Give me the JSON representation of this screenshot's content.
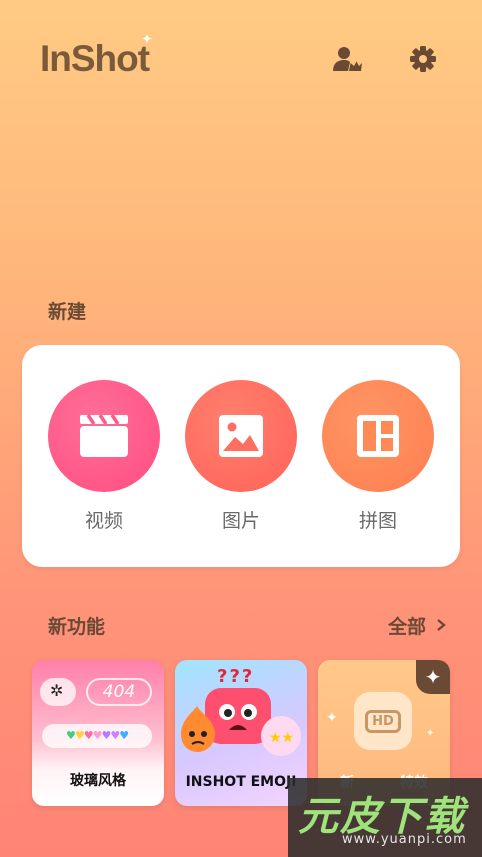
{
  "app": {
    "logo_text": "InShot"
  },
  "header": {
    "profile_icon": "vip-user-crown-icon",
    "settings_icon": "gear-icon"
  },
  "create": {
    "title": "新建",
    "items": [
      {
        "label": "视频",
        "icon": "clapperboard-icon",
        "color": "#FF5A89"
      },
      {
        "label": "图片",
        "icon": "image-icon",
        "color": "#FF6F60"
      },
      {
        "label": "拼图",
        "icon": "collage-layout-icon",
        "color": "#FF8A55"
      }
    ]
  },
  "features": {
    "title": "新功能",
    "see_all": "全部",
    "items": [
      {
        "label": "玻璃风格",
        "badge_text": "404"
      },
      {
        "label": "INSHOT EMOJI",
        "question_marks": "???"
      },
      {
        "label": "新",
        "hd_text": "HD",
        "extra_label": "特效"
      }
    ]
  },
  "watermark": {
    "main": "元皮下载",
    "url": "www.yuanpi.com"
  }
}
